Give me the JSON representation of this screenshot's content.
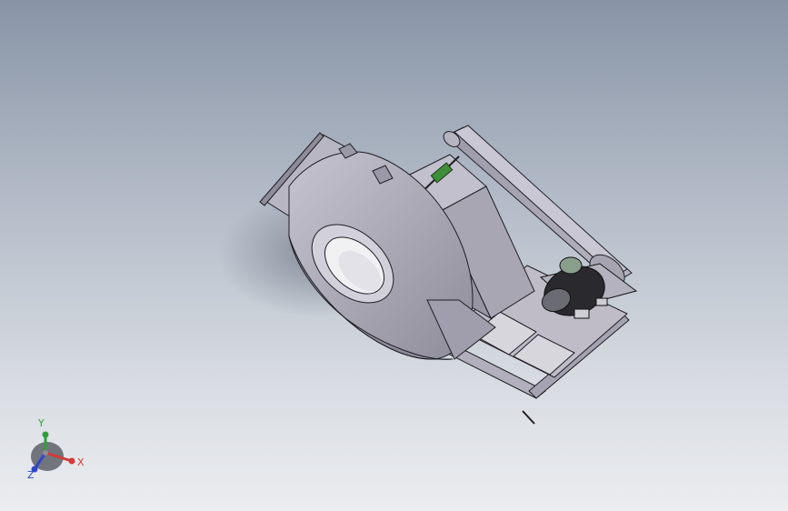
{
  "viewport": {
    "background_top": "#8894a6",
    "background_bottom": "#ebedf0"
  },
  "model": {
    "name": "centrifugal-fan-assembly",
    "body_color": "#a9a6b3",
    "edge_color": "#1e1e24",
    "bracket_color": "#3f8f3a",
    "motor_color": "#2a2a2e"
  },
  "triad": {
    "x_label": "X",
    "y_label": "Y",
    "z_label": "Z",
    "x_color": "#d23a3a",
    "y_color": "#2e9e3a",
    "z_color": "#2f45c8"
  }
}
